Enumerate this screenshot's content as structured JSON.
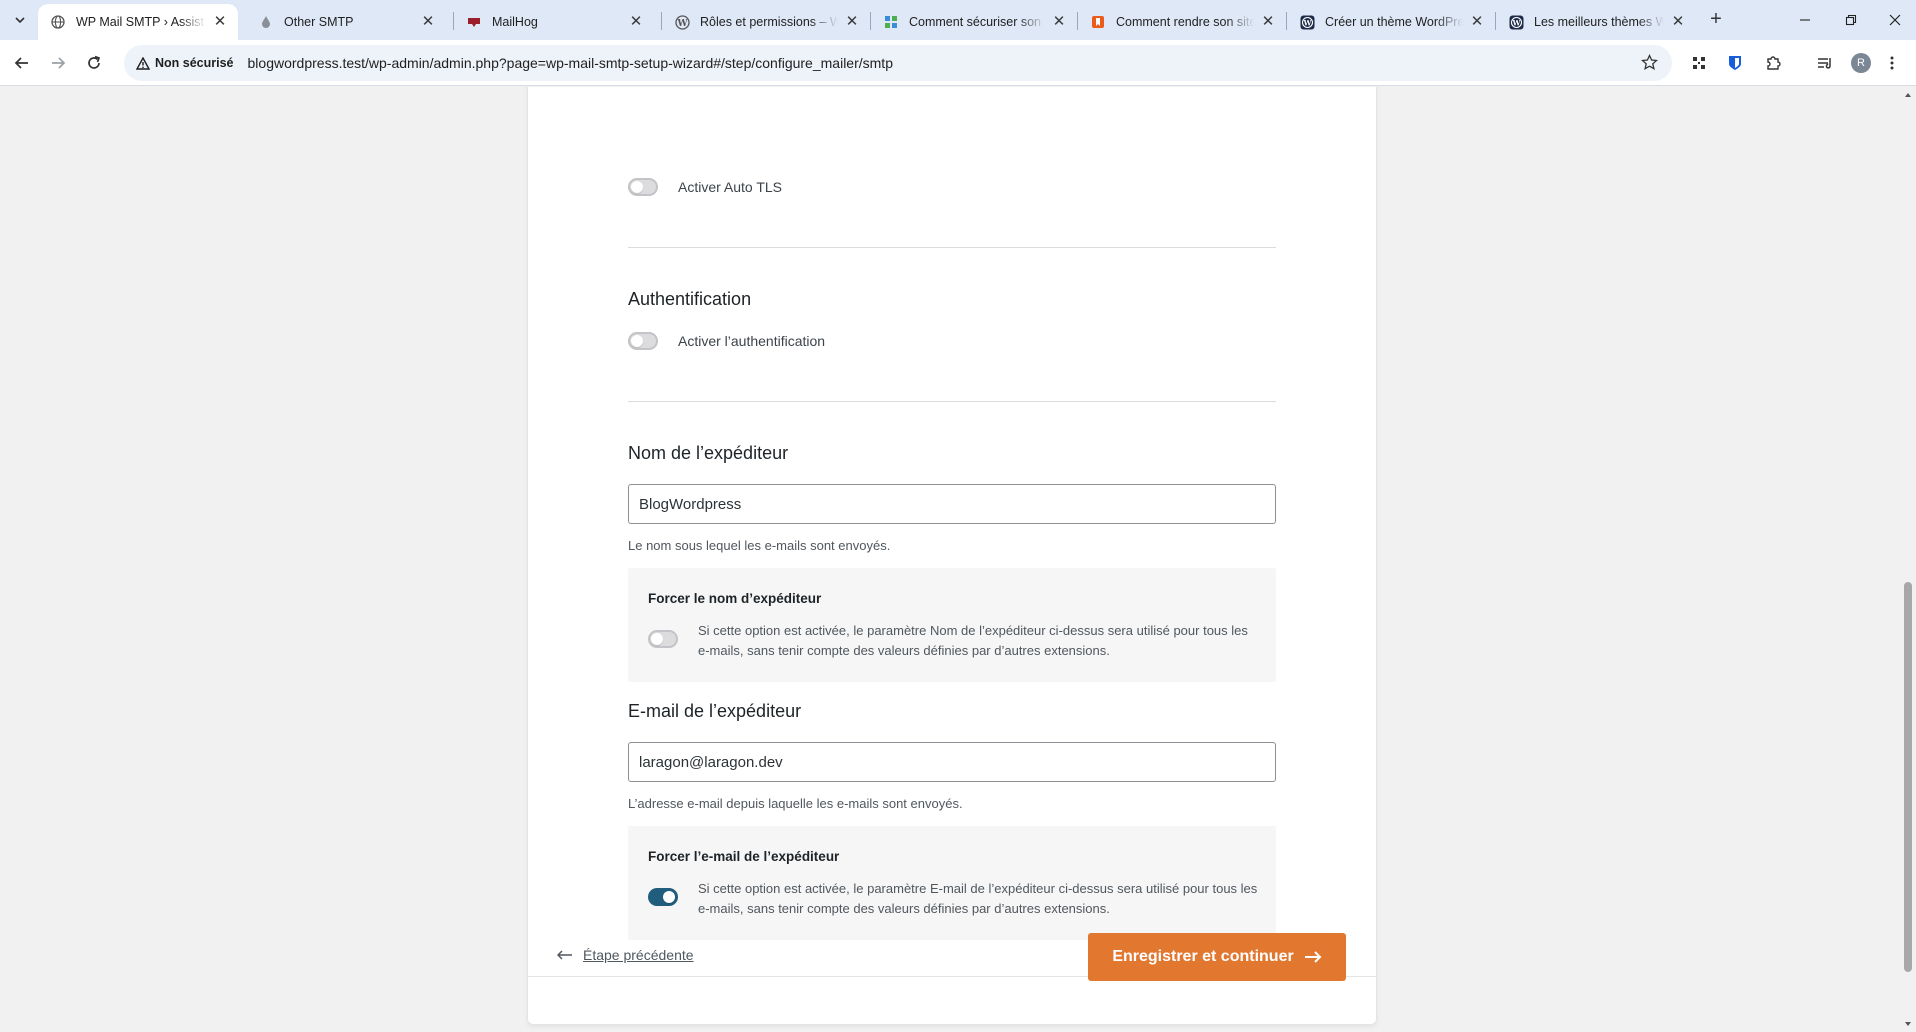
{
  "browser": {
    "tabs": [
      {
        "title": "WP Mail SMTP › Assistant",
        "active": true
      },
      {
        "title": "Other SMTP",
        "active": false
      },
      {
        "title": "MailHog",
        "active": false
      },
      {
        "title": "Rôles et permissions – W",
        "active": false
      },
      {
        "title": "Comment sécuriser son si",
        "active": false
      },
      {
        "title": "Comment rendre son site",
        "active": false
      },
      {
        "title": "Créer un thème WordPres",
        "active": false
      },
      {
        "title": "Les meilleurs thèmes Wor",
        "active": false
      }
    ],
    "security_label": "Non sécurisé",
    "url": "blogwordpress.test/wp-admin/admin.php?page=wp-mail-smtp-setup-wizard#/step/configure_mailer/smtp",
    "avatar_letter": "R"
  },
  "form": {
    "auto_tls": {
      "label": "Activer Auto TLS",
      "enabled": false
    },
    "auth": {
      "title": "Authentification",
      "label": "Activer l’authentification",
      "enabled": false
    },
    "from_name": {
      "title": "Nom de l’expéditeur",
      "value": "BlogWordpress",
      "description": "Le nom sous lequel les e-mails sont envoyés.",
      "force_title": "Forcer le nom d’expéditeur",
      "force_text": "Si cette option est activée, le paramètre Nom de l’expéditeur ci-dessus sera utilisé pour tous les e-mails, sans tenir compte des valeurs définies par d’autres extensions.",
      "force_enabled": false
    },
    "from_email": {
      "title": "E-mail de l’expéditeur",
      "value": "laragon@laragon.dev",
      "description": "L’adresse e-mail depuis laquelle les e-mails sont envoyés.",
      "force_title": "Forcer l’e-mail de l’expéditeur",
      "force_text": "Si cette option est activée, le paramètre E-mail de l’expéditeur ci-dessus sera utilisé pour tous les e-mails, sans tenir compte des valeurs définies par d’autres extensions.",
      "force_enabled": true
    }
  },
  "footer": {
    "prev_label": "Étape précédente",
    "next_label": "Enregistrer et continuer"
  },
  "colors": {
    "accent": "#e27730",
    "toggle_on": "#215d7c"
  }
}
